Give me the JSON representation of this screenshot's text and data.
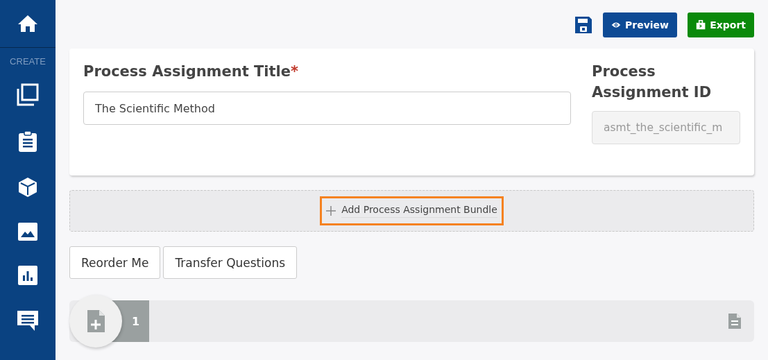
{
  "sidebar": {
    "section_label": "CREATE"
  },
  "toolbar": {
    "buttons": [
      {
        "label": "Preview",
        "kind": "preview"
      },
      {
        "label": "Export",
        "kind": "export"
      }
    ]
  },
  "form": {
    "title_label": "Process Assignment Title",
    "required_mark": "*",
    "title_value": "The Scientific Method",
    "id_label": "Process Assignment ID",
    "id_value": "asmt_the_scientific_m"
  },
  "add_bundle": {
    "label": "Add Process Assignment Bundle",
    "highlighted": true
  },
  "actions": [
    "Reorder Me",
    "Transfer Questions"
  ],
  "bundles": [
    {
      "number": "1"
    }
  ]
}
